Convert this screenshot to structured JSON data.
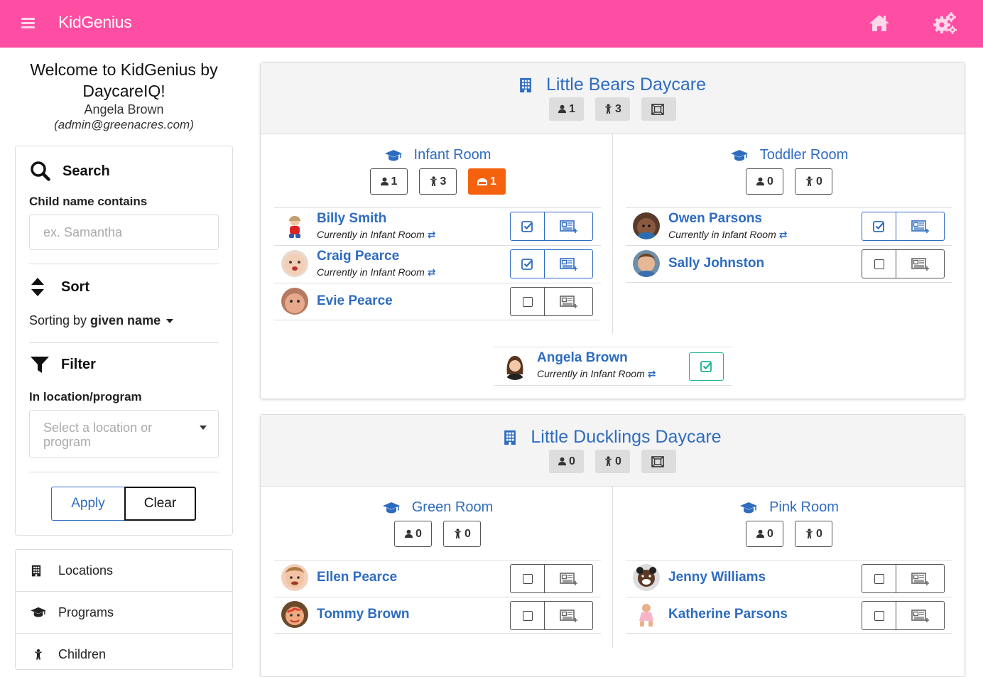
{
  "app": {
    "title": "KidGenius"
  },
  "welcome": {
    "heading": "Welcome to KidGenius by DaycareIQ!",
    "name": "Angela Brown",
    "email": "(admin@greenacres.com)"
  },
  "search": {
    "title": "Search",
    "label": "Child name contains",
    "placeholder": "ex. Samantha"
  },
  "sort": {
    "title": "Sort",
    "prefix": "Sorting by ",
    "value": "given name"
  },
  "filter": {
    "title": "Filter",
    "label": "In location/program",
    "placeholder": "Select a location or program",
    "apply": "Apply",
    "clear": "Clear"
  },
  "nav": [
    {
      "label": "Locations",
      "icon": "building-icon"
    },
    {
      "label": "Programs",
      "icon": "graduation-cap-icon"
    },
    {
      "label": "Children",
      "icon": "child-icon"
    }
  ],
  "daycares": [
    {
      "name": "Little Bears Daycare",
      "staff_count": "1",
      "child_count": "3",
      "rooms": [
        {
          "name": "Infant Room",
          "staff_count": "1",
          "child_count": "3",
          "alert_count": "1",
          "children": [
            {
              "name": "Billy Smith",
              "status": "Currently in Infant Room",
              "checked_in": true
            },
            {
              "name": "Craig Pearce",
              "status": "Currently in Infant Room",
              "checked_in": true
            },
            {
              "name": "Evie Pearce",
              "status": "",
              "checked_in": false
            }
          ]
        },
        {
          "name": "Toddler Room",
          "staff_count": "0",
          "child_count": "0",
          "children": [
            {
              "name": "Owen Parsons",
              "status": "Currently in Infant Room",
              "checked_in": true
            },
            {
              "name": "Sally Johnston",
              "status": "",
              "checked_in": false
            }
          ]
        }
      ],
      "staff": {
        "name": "Angela Brown",
        "status": "Currently in Infant Room",
        "checked_in": true
      }
    },
    {
      "name": "Little Ducklings Daycare",
      "staff_count": "0",
      "child_count": "0",
      "rooms": [
        {
          "name": "Green Room",
          "staff_count": "0",
          "child_count": "0",
          "children": [
            {
              "name": "Ellen Pearce",
              "checked_in": false
            },
            {
              "name": "Tommy Brown",
              "checked_in": false
            }
          ]
        },
        {
          "name": "Pink Room",
          "staff_count": "0",
          "child_count": "0",
          "children": [
            {
              "name": "Jenny Williams",
              "checked_in": false
            },
            {
              "name": "Katherine Parsons",
              "checked_in": false
            }
          ]
        }
      ]
    }
  ],
  "colors": {
    "brand": "#fe4ea3",
    "link": "#2e6cc0",
    "alert": "#f5620e",
    "staff_check": "#1ab394"
  }
}
